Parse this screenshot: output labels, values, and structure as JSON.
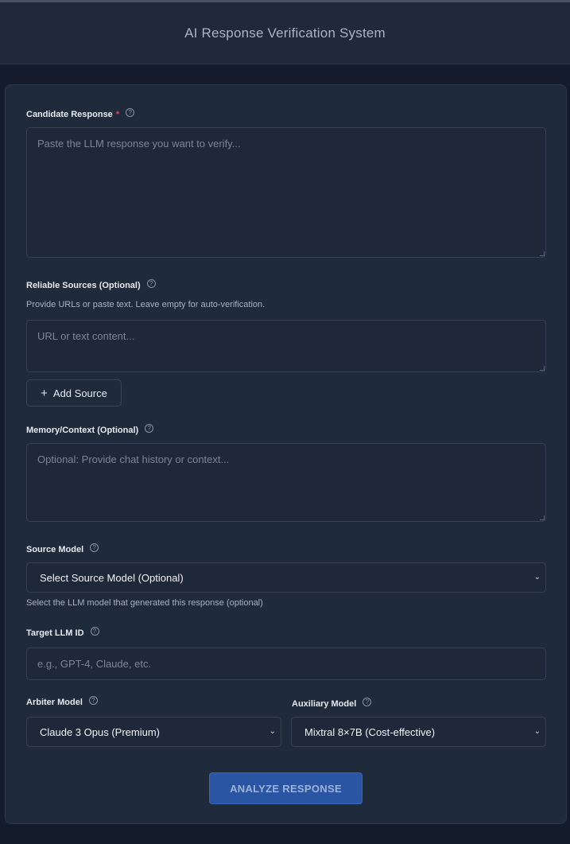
{
  "header": {
    "title": "AI Response Verification System"
  },
  "candidate": {
    "label": "Candidate Response",
    "required_mark": "*",
    "placeholder": "Paste the LLM response you want to verify..."
  },
  "sources": {
    "label": "Reliable Sources (Optional)",
    "hint": "Provide URLs or paste text. Leave empty for auto-verification.",
    "placeholder": "URL or text content...",
    "add_icon": "plus-icon",
    "add_label": "Add Source"
  },
  "memory": {
    "label": "Memory/Context (Optional)",
    "placeholder": "Optional: Provide chat history or context..."
  },
  "source_model": {
    "label": "Source Model",
    "selected": "Select Source Model (Optional)",
    "hint": "Select the LLM model that generated this response (optional)"
  },
  "target": {
    "label": "Target LLM ID",
    "placeholder": "e.g., GPT-4, Claude, etc."
  },
  "arbiter": {
    "label": "Arbiter Model",
    "selected": "Claude 3 Opus (Premium)"
  },
  "auxiliary": {
    "label": "Auxiliary Model",
    "selected": "Mixtral 8×7B (Cost-effective)"
  },
  "analyze": {
    "label": "ANALYZE RESPONSE"
  },
  "icons": {
    "help": "help-circle-icon",
    "chevron": "chevron-down-icon"
  },
  "colors": {
    "background": "#141c2c",
    "card": "#1f2a3b",
    "accent": "#2a55a3",
    "required": "#e5484d"
  }
}
